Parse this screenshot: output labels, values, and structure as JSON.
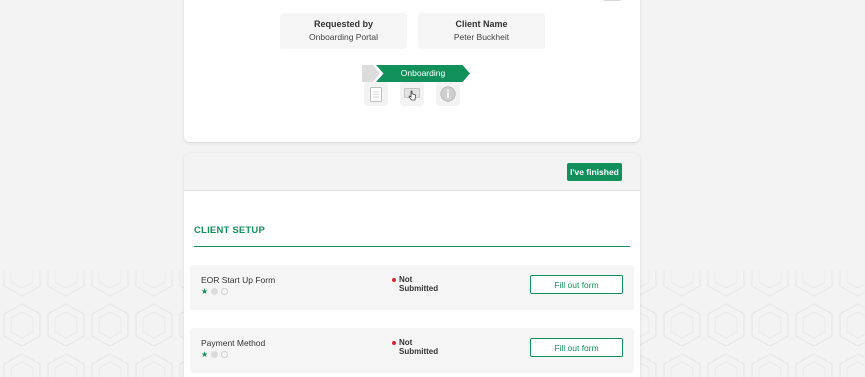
{
  "header_card": {
    "requested_by_label": "Requested by",
    "requested_by_value": "Onboarding Portal",
    "client_name_label": "Client Name",
    "client_name_value": "Peter Buckheit",
    "pipeline_step": "Onboarding",
    "icons": [
      "document-icon",
      "hand-pointer-icon",
      "info-icon"
    ]
  },
  "main_card": {
    "finish_label": "I've finished",
    "section_title": "CLIENT SETUP",
    "forms": [
      {
        "name": "EOR Start Up Form",
        "status_line1": "Not",
        "status_line2": "Submitted",
        "button_label": "Fill out form",
        "rating_filled": 1,
        "rating_total": 3
      },
      {
        "name": "Payment Method",
        "status_line1": "Not",
        "status_line2": "Submitted",
        "button_label": "Fill out form",
        "rating_filled": 1,
        "rating_total": 3
      }
    ]
  },
  "colors": {
    "accent": "#12905b",
    "status_red": "#d9263c",
    "background": "#f3f3f3"
  }
}
